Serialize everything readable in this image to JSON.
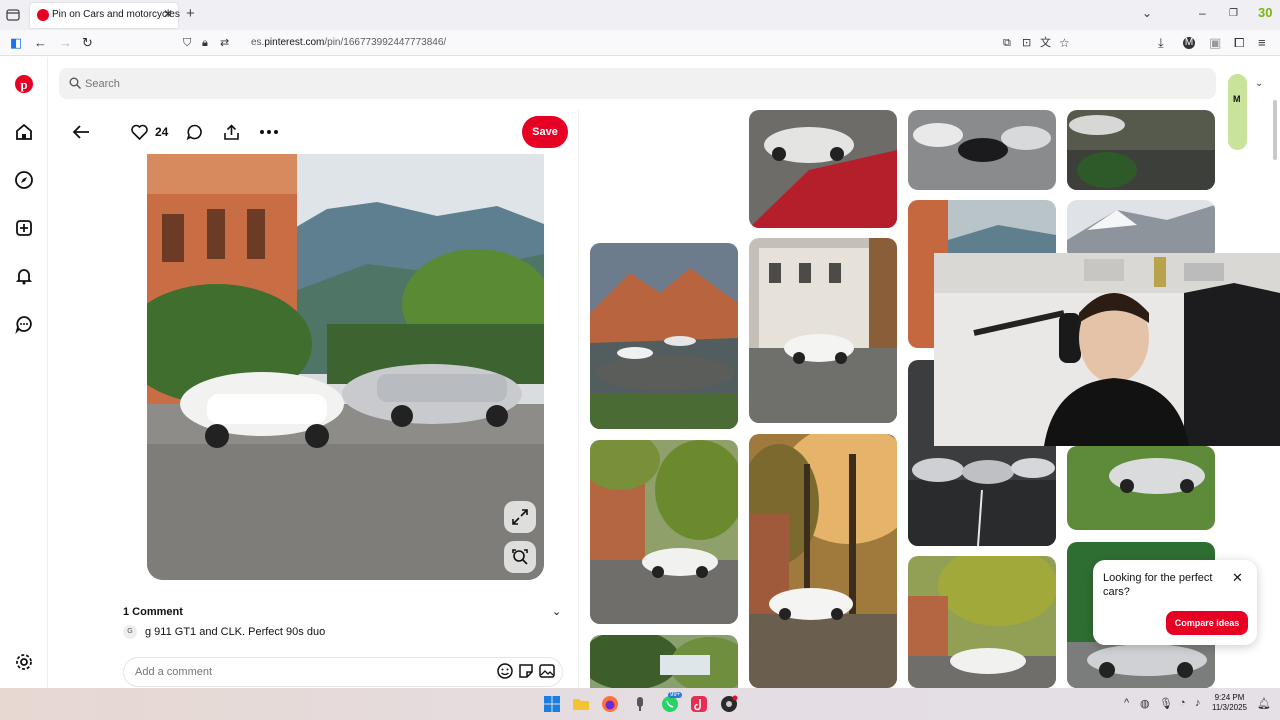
{
  "browser": {
    "tab_title": "Pin on Cars and motorcycles",
    "url_prefix": "es.",
    "url_domain": "pinterest.com",
    "url_path": "/pin/166773992447773846/",
    "extension_badge": "30"
  },
  "search": {
    "placeholder": "Search"
  },
  "avatar": {
    "initial": "M"
  },
  "pin": {
    "like_count": "24",
    "save_label": "Save",
    "comments_header": "1 Comment",
    "comment_author_initial": "G",
    "comment_text": "g 911 GT1 and CLK. Perfect 90s duo",
    "add_comment_placeholder": "Add a comment"
  },
  "popup": {
    "text": "Looking for the perfect cars?",
    "button_label": "Compare ideas"
  },
  "taskbar": {
    "whatsapp_badge": "99+",
    "time": "9:24 PM",
    "date": "11/3/2025"
  },
  "colors": {
    "brand": "#e60023",
    "accent_avatar": "#c9e39a"
  }
}
